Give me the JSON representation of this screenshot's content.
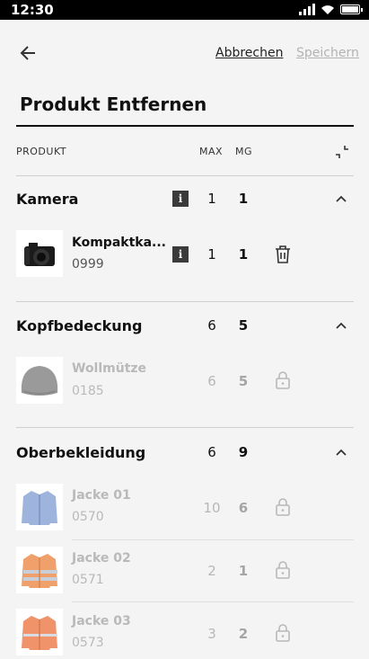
{
  "status": {
    "time": "12:30"
  },
  "header": {
    "cancel_label": "Abbrechen",
    "save_label": "Speichern"
  },
  "title": "Produkt Entfernen",
  "columns": {
    "product": "PRODUKT",
    "max": "MAX",
    "mg": "MG"
  },
  "categories": [
    {
      "name": "Kamera",
      "max": "1",
      "mg": "1",
      "info": "i",
      "items": [
        {
          "name": "Kompaktka...",
          "number": "0999",
          "max": "1",
          "mg": "1",
          "info": "i",
          "action": "trash-icon"
        }
      ]
    },
    {
      "name": "Kopfbedeckung",
      "max": "6",
      "mg": "5",
      "items": [
        {
          "name": "Wollmütze",
          "number": "0185",
          "max": "6",
          "mg": "5",
          "action": "lock-icon"
        }
      ]
    },
    {
      "name": "Oberbekleidung",
      "max": "6",
      "mg": "9",
      "items": [
        {
          "name": "Jacke 01",
          "number": "0570",
          "max": "10",
          "mg": "6",
          "action": "lock-icon"
        },
        {
          "name": "Jacke 02",
          "number": "0571",
          "max": "2",
          "mg": "1",
          "action": "lock-icon"
        },
        {
          "name": "Jacke 03",
          "number": "0573",
          "max": "3",
          "mg": "2",
          "action": "lock-icon"
        }
      ]
    }
  ]
}
